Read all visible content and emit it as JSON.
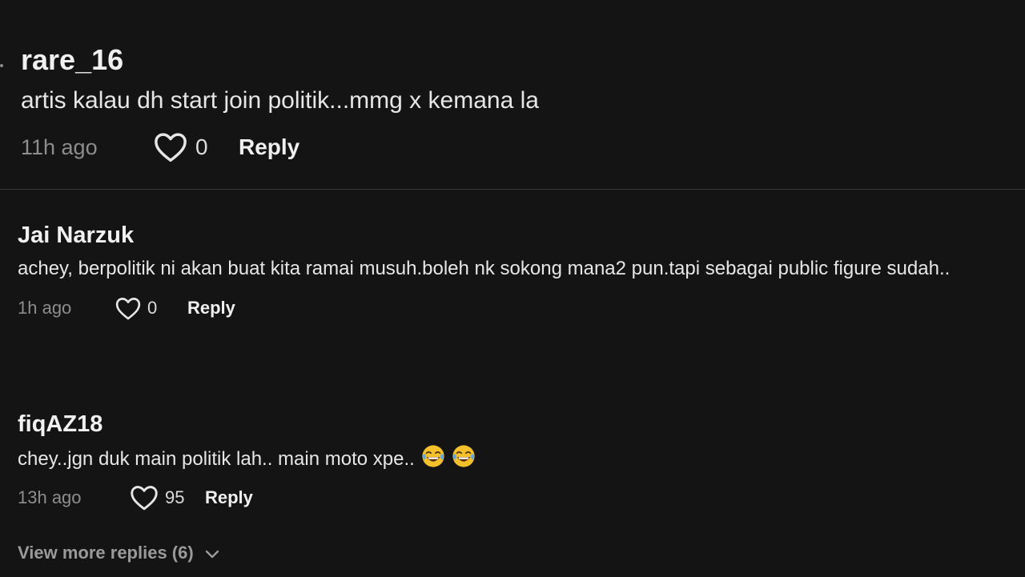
{
  "comments": [
    {
      "username": "rare_16",
      "text": "artis kalau dh start join politik...mmg x kemana la",
      "time": "11h ago",
      "likes": "0",
      "reply_label": "Reply"
    },
    {
      "username": "Jai Narzuk",
      "text": "achey, berpolitik ni akan buat kita ramai musuh.boleh nk sokong mana2 pun.tapi sebagai public figure sudah..",
      "time": "1h ago",
      "likes": "0",
      "reply_label": "Reply"
    },
    {
      "username": "fiqAZ18",
      "text": "chey..jgn duk main politik lah.. main moto xpe..",
      "emoji": [
        "face-with-tears-of-joy-icon",
        "face-with-tears-of-joy-icon"
      ],
      "time": "13h ago",
      "likes": "95",
      "reply_label": "Reply"
    }
  ],
  "view_more": {
    "label": "View more replies (6)",
    "icon": "chevron-down-icon"
  },
  "colors": {
    "background": "#141414",
    "muted_text": "#8d8d8d",
    "primary_text": "#f1f1f1",
    "divider": "#3a3a3a"
  }
}
